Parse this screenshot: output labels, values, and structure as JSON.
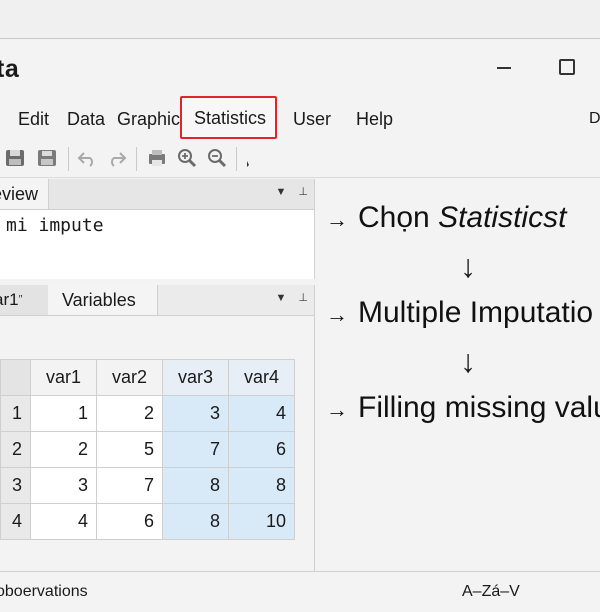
{
  "window": {
    "title": "ta"
  },
  "menu": {
    "items": [
      "Edit",
      "Data",
      "Graphics",
      "Statistics",
      "User",
      "Help"
    ],
    "right_label": "D"
  },
  "toolbar": {
    "icons": [
      "save-icon",
      "print-icon",
      "undo-icon",
      "redo-icon",
      "print-preview-icon",
      "zoom-in-icon",
      "zoom-out-icon",
      "pointer-icon"
    ]
  },
  "review": {
    "tab_label": "eview",
    "command": "mi impute"
  },
  "variables_panel": {
    "tab1_label": "ar1",
    "tab2_label": "Variables"
  },
  "grid": {
    "columns": [
      "var1",
      "var2",
      "var3",
      "var4"
    ],
    "rows": [
      {
        "num": "1",
        "values": [
          "1",
          "2",
          "3",
          "4"
        ]
      },
      {
        "num": "2",
        "values": [
          "2",
          "5",
          "7",
          "6"
        ]
      },
      {
        "num": "3",
        "values": [
          "3",
          "7",
          "8",
          "8"
        ]
      },
      {
        "num": "4",
        "values": [
          "4",
          "6",
          "8",
          "10"
        ]
      }
    ],
    "highlight_color": "#d8e9f8"
  },
  "annotations": {
    "step1_prefix": "Chọn ",
    "step1_emph": "Statisticst",
    "step2": "Multiple Imputatio",
    "step3": "Filling missing valu",
    "arrow_right": "→",
    "arrow_down": "↓"
  },
  "status": {
    "left": "oboervations",
    "right": "A–Zá–V"
  },
  "colors": {
    "menu_highlight": "#e0242a"
  }
}
